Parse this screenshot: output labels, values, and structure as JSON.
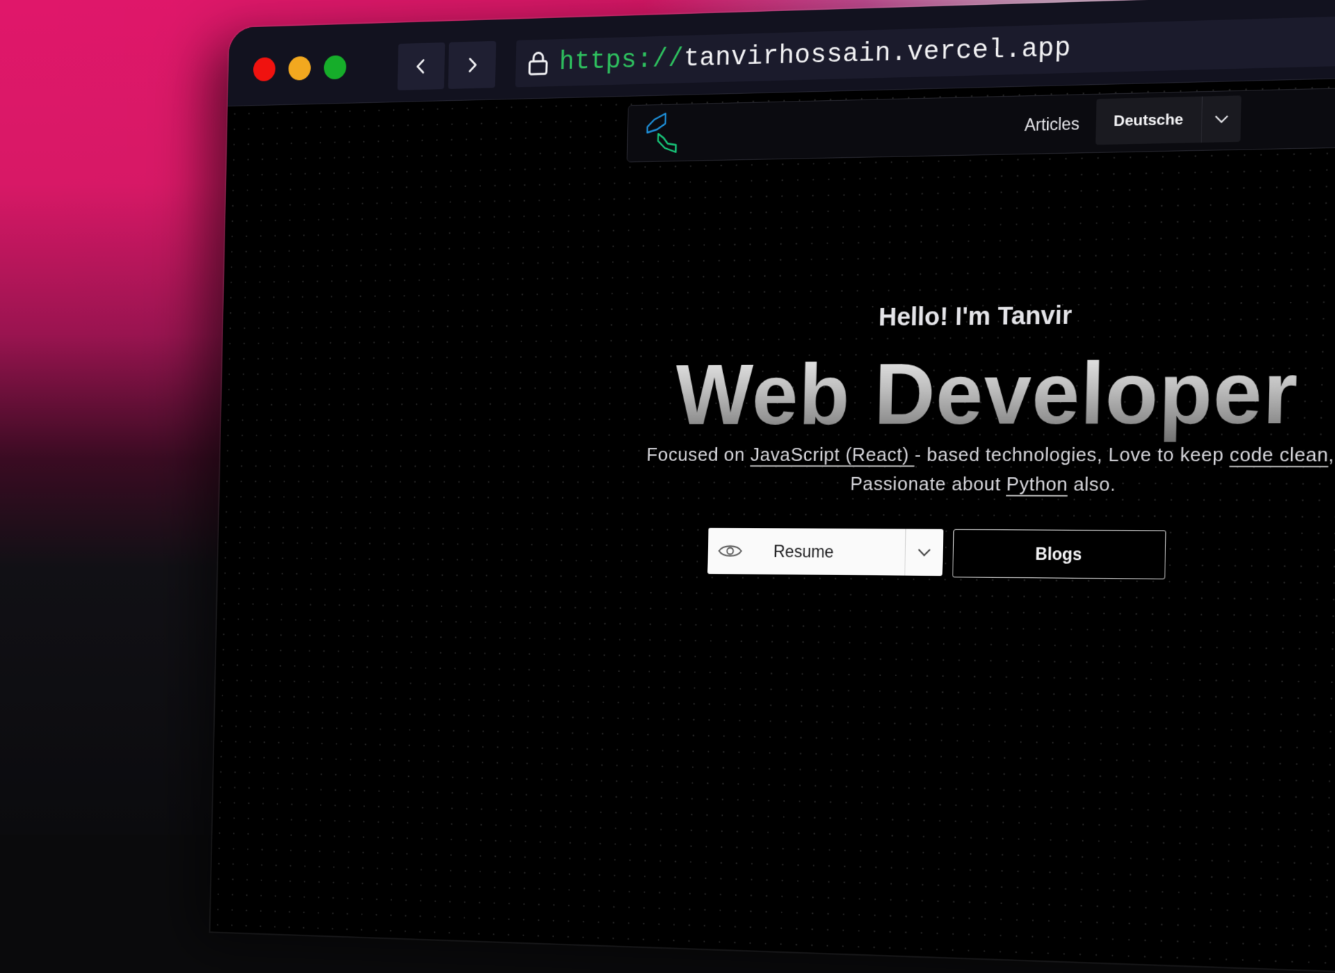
{
  "browser": {
    "url_scheme": "https://",
    "url_host": "tanvirhossain.vercel.app"
  },
  "site": {
    "nav": {
      "articles_label": "Articles",
      "language_label": "Deutsche"
    },
    "hero": {
      "greeting": "Hello! I'm Tanvir",
      "title": "Web Developer",
      "desc_1": "Focused on ",
      "desc_link_1": "JavaScript (React) ",
      "desc_2": "- based technologies, Love to keep ",
      "desc_link_2": "code clean",
      "desc_3": ", Passionate about ",
      "desc_link_3": "Python",
      "desc_4": " also.",
      "resume_label": "Resume",
      "blogs_label": "Blogs"
    }
  },
  "colors": {
    "url_scheme": "#2ec15f",
    "close_dot": "#f0120f",
    "minimize_dot": "#f2a81f",
    "maximize_dot": "#16ad2a",
    "logo_blue": "#1e8fd8",
    "logo_green": "#18c77a"
  },
  "icons": {
    "back": "chevron-left-icon",
    "forward": "chevron-right-icon",
    "lock": "lock-icon",
    "logo": "site-logo",
    "language_dropdown": "chevron-down-icon",
    "resume_view": "eye-icon",
    "resume_dropdown": "chevron-down-icon"
  }
}
